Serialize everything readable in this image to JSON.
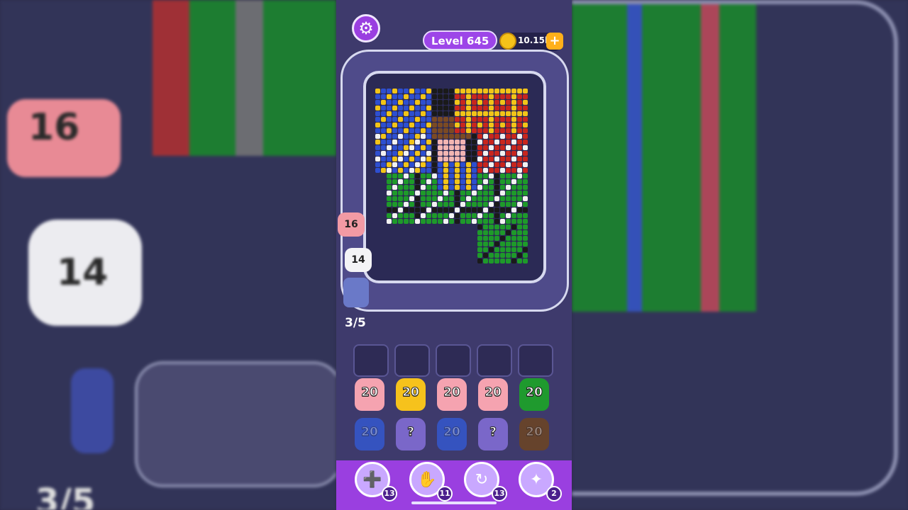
{
  "header": {
    "settings_icon": "gear-icon",
    "level_label": "Level 645",
    "coins": "10.15k",
    "add_coins_label": "+"
  },
  "board": {
    "track_pushers": [
      {
        "count": "16",
        "color": "#f29aa4"
      },
      {
        "count": "14",
        "color": "#f4f4f6"
      }
    ],
    "queue_counter": "3/5"
  },
  "slots": 5,
  "columns": [
    {
      "top": {
        "count": "20",
        "color": "#f5a3b0"
      },
      "second": {
        "count": "20",
        "color": "#3556c9"
      }
    },
    {
      "top": {
        "count": "20",
        "color": "#f6c21c"
      },
      "second": {
        "count": "?",
        "color": "#7a67c9"
      }
    },
    {
      "top": {
        "count": "20",
        "color": "#f5a3b0"
      },
      "second": {
        "count": "20",
        "color": "#3556c9"
      }
    },
    {
      "top": {
        "count": "20",
        "color": "#f5a3b0"
      },
      "second": {
        "count": "?",
        "color": "#7a67c9"
      }
    },
    {
      "top": {
        "count": "20",
        "color": "#1f9a2e"
      },
      "second": {
        "count": "20",
        "color": "#6b4426"
      }
    }
  ],
  "powerups": [
    {
      "name": "add-slot",
      "icon": "add-card-icon",
      "count": "13"
    },
    {
      "name": "hand",
      "icon": "hand-icon",
      "count": "11"
    },
    {
      "name": "shuffle",
      "icon": "shuffle-icon",
      "count": "13"
    },
    {
      "name": "magnet",
      "icon": "magnet-icon",
      "count": "2"
    }
  ],
  "background_labels": {
    "left_pusher_1": "16",
    "left_pusher_2": "14",
    "left_counter": "3/5"
  }
}
